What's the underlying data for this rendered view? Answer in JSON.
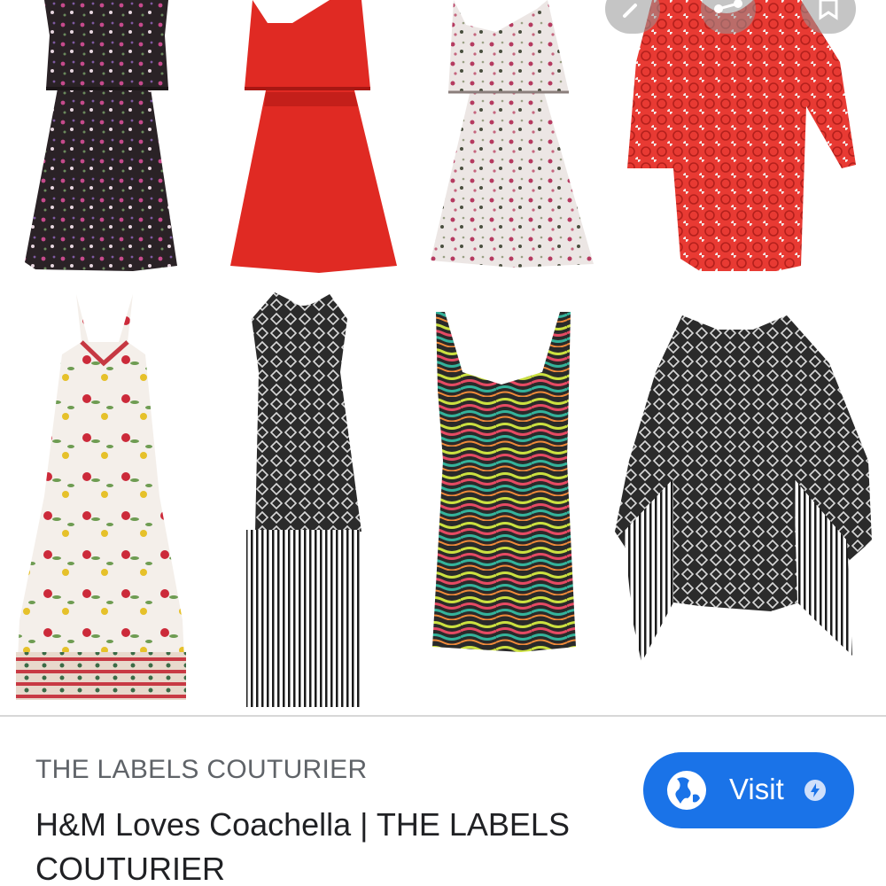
{
  "result": {
    "source": "THE LABELS COUTURIER",
    "title": "H&M Loves Coachella | THE LABELS COUTURIER",
    "visit_label": "Visit"
  },
  "image": {
    "description_icon": "product-collage-image",
    "items": [
      {
        "name": "dress-black-floral-cami"
      },
      {
        "name": "dress-red-cami"
      },
      {
        "name": "dress-white-floral-cami"
      },
      {
        "name": "dress-red-lace"
      },
      {
        "name": "dress-floral-maxi"
      },
      {
        "name": "dress-black-fringe"
      },
      {
        "name": "dress-striped-bodycon"
      },
      {
        "name": "top-black-fringe-kimono"
      }
    ]
  },
  "icons": {
    "overlay_left": "link-icon",
    "overlay_mid": "share-icon",
    "overlay_right": "bookmark-icon",
    "visit": "globe-icon",
    "amp": "amp-icon"
  },
  "colors": {
    "accent": "#1a73e8",
    "source_text": "#5f6368",
    "title_text": "#202124"
  }
}
